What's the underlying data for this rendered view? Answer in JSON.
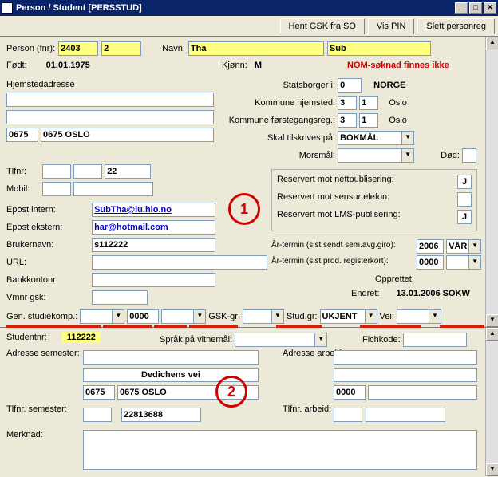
{
  "window": {
    "title": "Person / Student   [PERSSTUD]"
  },
  "toolbar": {
    "hentGsk": "Hent GSK fra SO",
    "visPin": "Vis PIN",
    "slettPersonreg": "Slett personreg"
  },
  "person": {
    "fnr_label": "Person (fnr):",
    "fnr1": "2403",
    "fnr2": "2",
    "navn_label": "Navn:",
    "navn1": "Tha",
    "navn2": "Sub",
    "fodt_label": "Født:",
    "fodt": "01.01.1975",
    "kjonn_label": "Kjønn:",
    "kjonn": "M",
    "nom_warning": "NOM-søknad finnes ikke"
  },
  "adresse": {
    "hjem_label": "Hjemstedadresse",
    "linje1": "",
    "linje2": "",
    "postnr": "0675",
    "poststed": "0675 OSLO",
    "statsborger_label": "Statsborger i:",
    "statsborger_kode": "0",
    "statsborger_land": "NORGE",
    "komm_hjem_label": "Kommune hjemsted:",
    "komm_hjem1": "3",
    "komm_hjem2": "1",
    "komm_hjem_navn": "Oslo",
    "komm_f_label": "Kommune førstegangsreg.:",
    "komm_f1": "3",
    "komm_f2": "1",
    "komm_f_navn": "Oslo",
    "tilskrives_label": "Skal tilskrives på:",
    "tilskrives": "BOKMÅL",
    "morsmal_label": "Morsmål:",
    "dod_label": "Død:"
  },
  "kontakt": {
    "tlfnr_label": "Tlfnr:",
    "tlf1": "",
    "tlf2": "",
    "tlf3": "22",
    "mobil_label": "Mobil:",
    "mobil1": "",
    "mobil2": "",
    "epost_int_label": "Epost intern:",
    "epost_int": "SubTha@iu.hio.no",
    "epost_ekst_label": "Epost ekstern:",
    "epost_ekst": "har@hotmail.com",
    "bruker_label": "Brukernavn:",
    "bruker": "s112222",
    "url_label": "URL:",
    "bank_label": "Bankkontonr:",
    "vmnr_label": "Vmnr gsk:"
  },
  "reservasjon": {
    "nett_label": "Reservert mot nettpublisering:",
    "nett": "J",
    "sensur_label": "Reservert mot sensurtelefon:",
    "sensur": "",
    "lms_label": "Reservert mot LMS-publisering:",
    "lms": "J"
  },
  "termin": {
    "semavg_label": "År-termin (sist sendt sem.avg.giro):",
    "semavg_ar": "2006",
    "semavg_term": "VÅR",
    "regkort_label": "År-termin (sist prod. registerkort):",
    "regkort_ar": "0000",
    "opprettet_label": "Opprettet:",
    "endret_label": "Endret:",
    "endret_val": "13.01.2006  SOKW"
  },
  "gsk": {
    "gen_label": "Gen. studiekomp.:",
    "gen_val": "0000",
    "gsk_gr_label": "GSK-gr:",
    "stud_gr_label": "Stud.gr:",
    "stud_gr_val": "UKJENT",
    "vei_label": "Vei:"
  },
  "student": {
    "studentnr_label": "Studentnr:",
    "studentnr": "112222",
    "sprak_label": "Språk på vitnemål:",
    "fichkode_label": "Fichkode:",
    "adr_sem_label": "Adresse semester:",
    "adr_arb_label": "Adresse arbeid:",
    "adr_sem_gate": "Dedichens vei",
    "adr_sem_postnr": "0675",
    "adr_sem_poststed": "0675 OSLO",
    "adr_arb_postnr": "0000",
    "tlf_sem_label": "Tlfnr. semester:",
    "tlf_sem": "22813688",
    "tlf_arb_label": "Tlfnr. arbeid:",
    "merknad_label": "Merknad:"
  },
  "annotations": {
    "a1": "1",
    "a2": "2"
  }
}
